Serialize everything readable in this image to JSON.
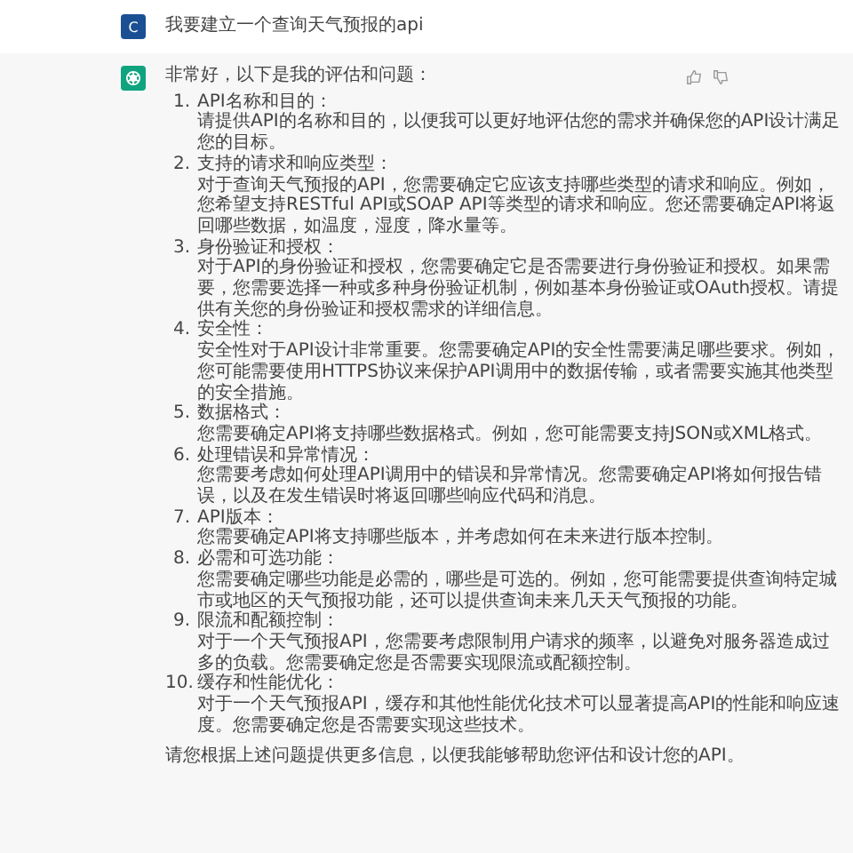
{
  "user_message": {
    "avatar_letter": "C",
    "text": "我要建立一个查询天气预报的api"
  },
  "assistant_message": {
    "intro": "非常好，以下是我的评估和问题：",
    "items": [
      {
        "number": "1.",
        "title": "API名称和目的：",
        "body": "请提供API的名称和目的，以便我可以更好地评估您的需求并确保您的API设计满足您的目标。"
      },
      {
        "number": "2.",
        "title": "支持的请求和响应类型：",
        "body": "对于查询天气预报的API，您需要确定它应该支持哪些类型的请求和响应。例如，您希望支持RESTful API或SOAP API等类型的请求和响应。您还需要确定API将返回哪些数据，如温度，湿度，降水量等。"
      },
      {
        "number": "3.",
        "title": "身份验证和授权：",
        "body": "对于API的身份验证和授权，您需要确定它是否需要进行身份验证和授权。如果需要，您需要选择一种或多种身份验证机制，例如基本身份验证或OAuth授权。请提供有关您的身份验证和授权需求的详细信息。"
      },
      {
        "number": "4.",
        "title": "安全性：",
        "body": "安全性对于API设计非常重要。您需要确定API的安全性需要满足哪些要求。例如，您可能需要使用HTTPS协议来保护API调用中的数据传输，或者需要实施其他类型的安全措施。"
      },
      {
        "number": "5.",
        "title": "数据格式：",
        "body": "您需要确定API将支持哪些数据格式。例如，您可能需要支持JSON或XML格式。"
      },
      {
        "number": "6.",
        "title": "处理错误和异常情况：",
        "body": "您需要考虑如何处理API调用中的错误和异常情况。您需要确定API将如何报告错误，以及在发生错误时将返回哪些响应代码和消息。"
      },
      {
        "number": "7.",
        "title": "API版本：",
        "body": "您需要确定API将支持哪些版本，并考虑如何在未来进行版本控制。"
      },
      {
        "number": "8.",
        "title": "必需和可选功能：",
        "body": "您需要确定哪些功能是必需的，哪些是可选的。例如，您可能需要提供查询特定城市或地区的天气预报功能，还可以提供查询未来几天天气预报的功能。"
      },
      {
        "number": "9.",
        "title": "限流和配额控制：",
        "body": "对于一个天气预报API，您需要考虑限制用户请求的频率，以避免对服务器造成过多的负载。您需要确定您是否需要实现限流或配额控制。"
      },
      {
        "number": "10.",
        "title": "缓存和性能优化：",
        "body": "对于一个天气预报API，缓存和其他性能优化技术可以显著提高API的性能和响应速度。您需要确定您是否需要实现这些技术。"
      }
    ],
    "closing": "请您根据上述问题提供更多信息，以便我能够帮助您评估和设计您的API。"
  }
}
